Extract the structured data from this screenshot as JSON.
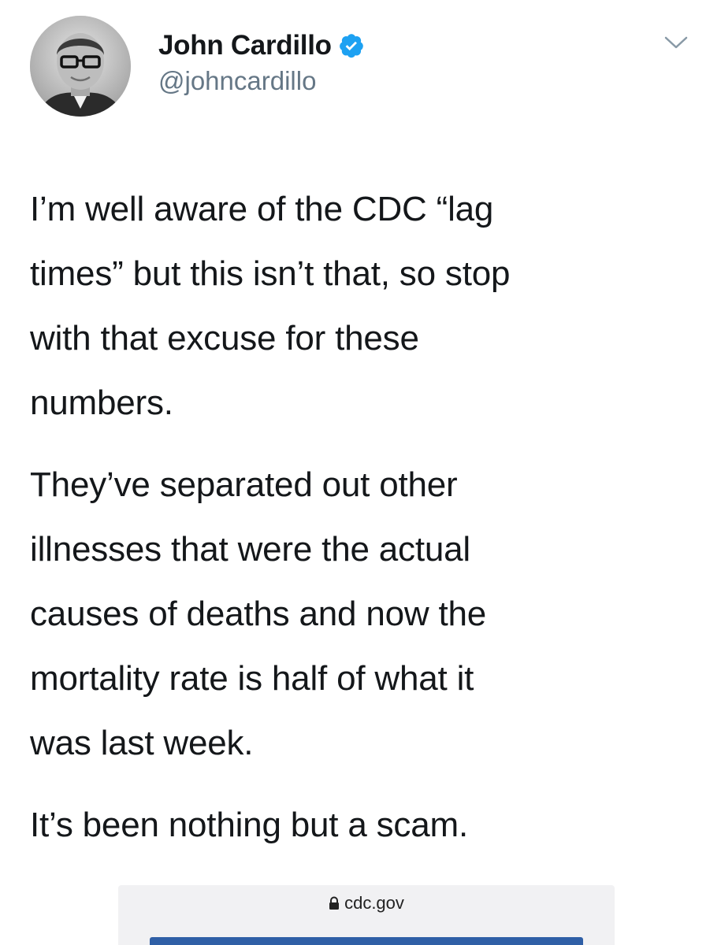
{
  "tweet": {
    "author": {
      "display_name": "John Cardillo",
      "handle": "@johncardillo",
      "verified": true
    },
    "paragraphs": [
      "I’m well aware of the CDC “lag\ntimes” but this isn’t that, so stop\nwith that excuse for these\nnumbers.",
      "They’ve separated out other\nillnesses that were the actual\ncauses of deaths and now the\nmortality rate is half of what it\nwas last week.",
      "It’s been nothing but a scam."
    ],
    "attached_image": {
      "url_text": "cdc.gov"
    }
  },
  "icons": {
    "verified": "verified-badge-icon",
    "caret": "chevron-down-icon",
    "lock": "lock-icon"
  },
  "colors": {
    "text": "#14171a",
    "secondary": "#657786",
    "verified_blue": "#1da1f2",
    "card_bg": "#f1f1f3",
    "card_strip": "#2f5fa6"
  }
}
